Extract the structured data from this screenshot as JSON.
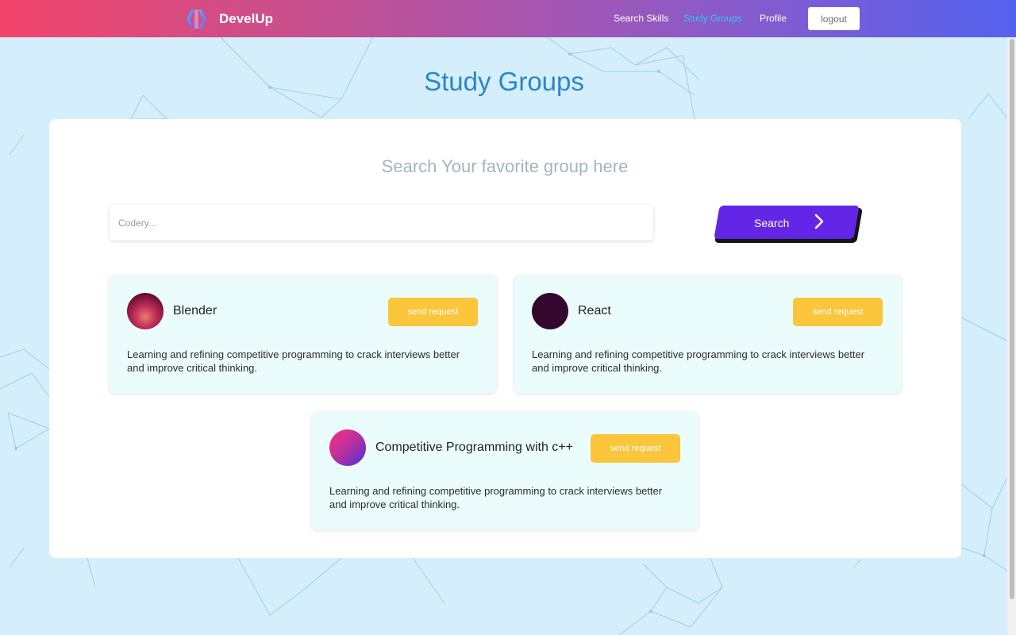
{
  "app": {
    "brand": "DevelUp"
  },
  "nav": {
    "search_skills": "Search Skills",
    "study_groups": "Study Groups",
    "profile": "Profile",
    "logout": "logout"
  },
  "page": {
    "title": "Study Groups",
    "search_heading": "Search Your favorite group here",
    "search_placeholder": "Codery...",
    "search_button": "Search"
  },
  "groups": [
    {
      "name": "Blender",
      "button": "send request",
      "description": "Learning and refining competitive programming to crack interviews better and improve critical thinking."
    },
    {
      "name": "React",
      "button": "send request",
      "description": "Learning and refining competitive programming to crack interviews better and improve critical thinking."
    },
    {
      "name": "Competitive Programming with c++",
      "button": "send request",
      "description": "Learning and refining competitive programming to crack interviews better and improve critical thinking."
    }
  ],
  "colors": {
    "nav_gradient_start": "#f2456b",
    "nav_gradient_end": "#5462ef",
    "active_link": "#2fc6f2",
    "title": "#2b86c9",
    "search_button": "#6326e6",
    "send_button": "#fbc53c",
    "card_bg": "#ebfcfd",
    "page_bg": "#d4effb"
  }
}
